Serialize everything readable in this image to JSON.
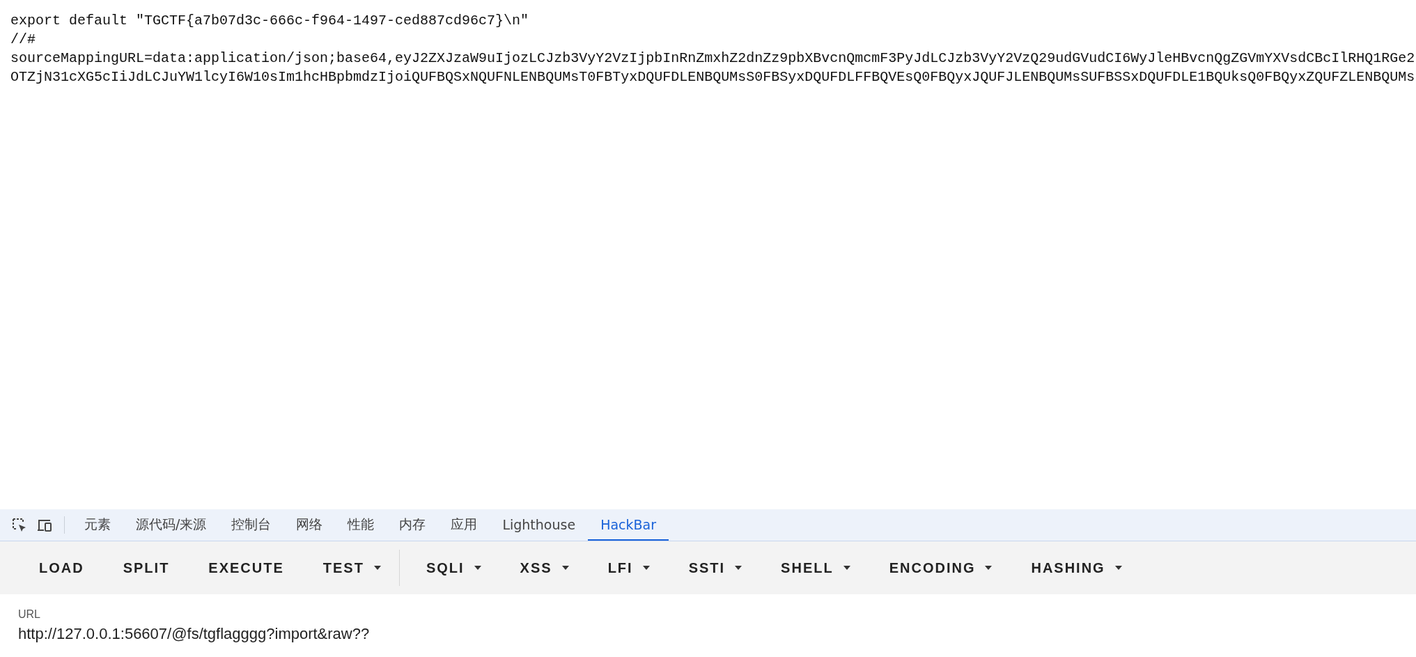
{
  "page_source": {
    "lines": [
      "export default \"TGCTF{a7b07d3c-666c-f964-1497-ced887cd96c7}\\n\"",
      "//#",
      "sourceMappingURL=data:application/json;base64,eyJ2ZXJzaW9uIjozLCJzb3VyY2VzIjpbInRnZmxhZ2dnZz9pbXBvcnQmcmF3PyJdLCJzb3VyY2VzQ29udGVudCI6WyJleHBvcnQgZGVmYXVsdCBcIlRHQ1RGe2",
      "OTZjN31cXG5cIiJdLCJuYW1lcyI6W10sIm1hcHBpbmdzIjoiQUFBQSxNQUFNLENBQUMsT0FBTyxDQUFDLENBQUMsS0FBSyxDQUFDLFFBQVEsQ0FBQyxJQUFJLENBQUMsSUFBSSxDQUFDLE1BQUksQ0FBQyxZQUFZLENBQUMs"
    ]
  },
  "devtools": {
    "tabs": [
      {
        "label": "元素",
        "selected": false
      },
      {
        "label": "源代码/来源",
        "selected": false
      },
      {
        "label": "控制台",
        "selected": false
      },
      {
        "label": "网络",
        "selected": false
      },
      {
        "label": "性能",
        "selected": false
      },
      {
        "label": "内存",
        "selected": false
      },
      {
        "label": "应用",
        "selected": false
      },
      {
        "label": "Lighthouse",
        "selected": false
      },
      {
        "label": "HackBar",
        "selected": true
      }
    ],
    "hackbar": {
      "buttons": [
        {
          "label": "LOAD",
          "dropdown": false,
          "separated": false
        },
        {
          "label": "SPLIT",
          "dropdown": false,
          "separated": false
        },
        {
          "label": "EXECUTE",
          "dropdown": false,
          "separated": false
        },
        {
          "label": "TEST",
          "dropdown": true,
          "separated": false
        },
        {
          "label": "SQLI",
          "dropdown": true,
          "separated": true
        },
        {
          "label": "XSS",
          "dropdown": true,
          "separated": false
        },
        {
          "label": "LFI",
          "dropdown": true,
          "separated": false
        },
        {
          "label": "SSTI",
          "dropdown": true,
          "separated": false
        },
        {
          "label": "SHELL",
          "dropdown": true,
          "separated": false
        },
        {
          "label": "ENCODING",
          "dropdown": true,
          "separated": false
        },
        {
          "label": "HASHING",
          "dropdown": true,
          "separated": false
        }
      ]
    },
    "url_field": {
      "label": "URL",
      "value": "http://127.0.0.1:56607/@fs/tgflagggg?import&raw??"
    }
  }
}
